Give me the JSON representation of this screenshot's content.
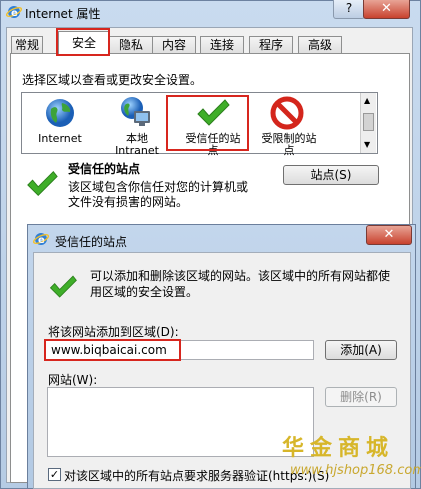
{
  "main_window": {
    "title": "Internet 属性",
    "help": "?",
    "close": "✕"
  },
  "tabs": [
    {
      "label": "常规"
    },
    {
      "label": "安全",
      "active": true
    },
    {
      "label": "隐私"
    },
    {
      "label": "内容"
    },
    {
      "label": "连接"
    },
    {
      "label": "程序"
    },
    {
      "label": "高级"
    }
  ],
  "security": {
    "zone_prompt": "选择区域以查看或更改安全设置。",
    "zones": [
      {
        "label_line1": "Internet",
        "label_line2": "",
        "icon": "globe-icon"
      },
      {
        "label_line1": "本地",
        "label_line2": "Intranet",
        "icon": "intranet-icon"
      },
      {
        "label_line1": "受信任的站",
        "label_line2": "点",
        "icon": "checkmark-icon",
        "selected": true
      },
      {
        "label_line1": "受限制的站",
        "label_line2": "点",
        "icon": "restricted-icon"
      }
    ],
    "selected_zone_title": "受信任的站点",
    "selected_zone_desc_line1": "该区域包含你信任对您的计算机或",
    "selected_zone_desc_line2": "文件没有损害的网站。",
    "sites_button": "站点(S)"
  },
  "dialog": {
    "title": "受信任的站点",
    "close": "✕",
    "desc_line1": "可以添加和删除该区域的网站。该区域中的所有网站都使",
    "desc_line2": "用区域的安全设置。",
    "add_label": "将该网站添加到区域(D):",
    "url_value": "www.biqbaicai.com",
    "add_button": "添加(A)",
    "sites_label": "网站(W):",
    "remove_button": "删除(R)",
    "verify_checked": true,
    "verify_label": "对该区域中的所有站点要求服务器验证(https:)(S)"
  },
  "watermark": {
    "brand": "华金商城",
    "url": "www.hjshop168.com"
  },
  "colors": {
    "highlight": "#d7261e",
    "check_green": "#3fae29",
    "restricted_red": "#d4261c"
  }
}
